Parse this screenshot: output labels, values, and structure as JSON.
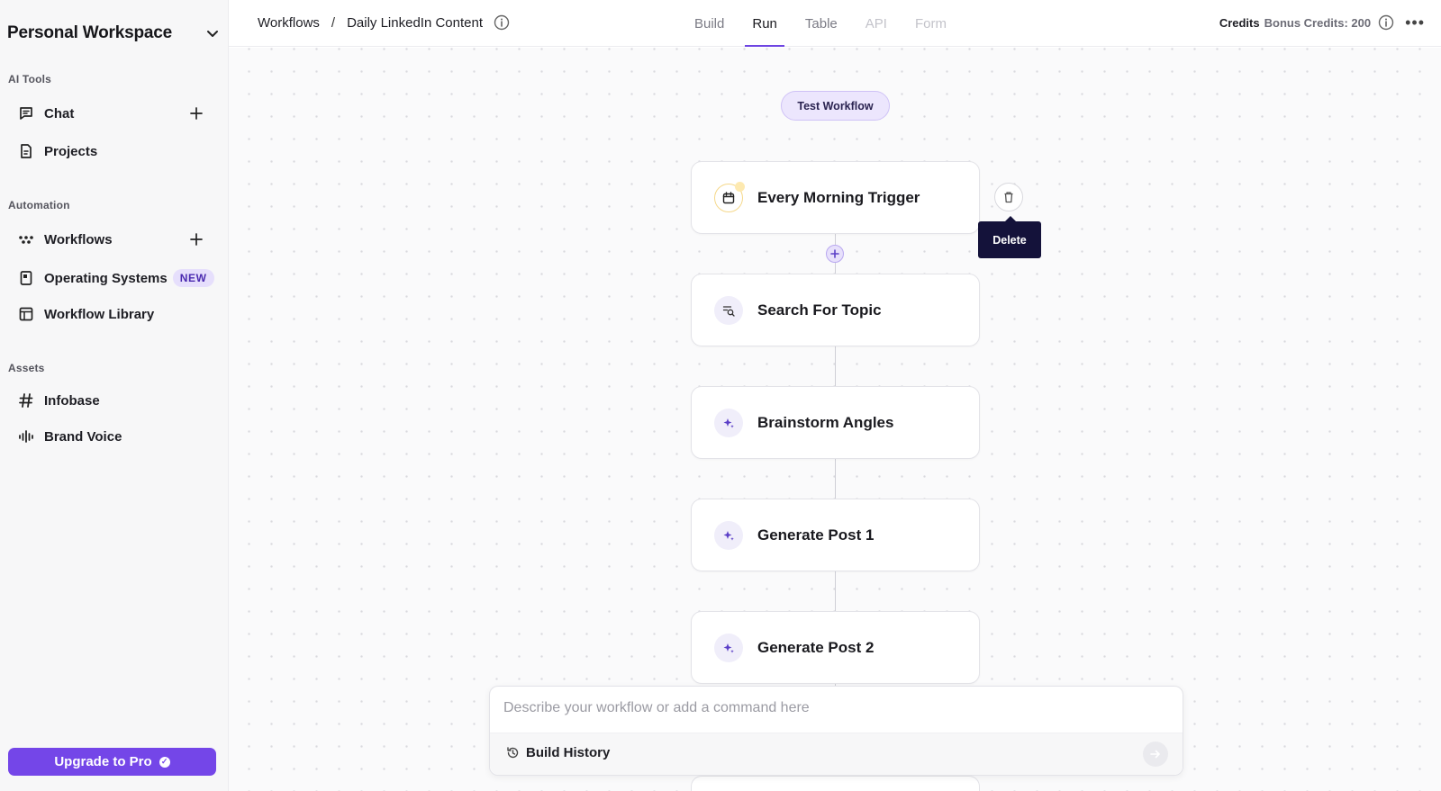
{
  "sidebar": {
    "workspace_title": "Personal Workspace",
    "sections": {
      "ai_tools": "AI Tools",
      "automation": "Automation",
      "assets": "Assets"
    },
    "items": {
      "chat": "Chat",
      "projects": "Projects",
      "workflows": "Workflows",
      "operating_systems": "Operating Systems",
      "operating_systems_badge": "NEW",
      "workflow_library": "Workflow Library",
      "infobase": "Infobase",
      "brand_voice": "Brand Voice"
    },
    "upgrade_label": "Upgrade to Pro"
  },
  "topbar": {
    "breadcrumb": [
      "Workflows",
      "Daily LinkedIn Content"
    ],
    "separator": "/",
    "tabs": [
      {
        "label": "Build",
        "state": "normal"
      },
      {
        "label": "Run",
        "state": "active"
      },
      {
        "label": "Table",
        "state": "normal"
      },
      {
        "label": "API",
        "state": "disabled"
      },
      {
        "label": "Form",
        "state": "disabled"
      }
    ],
    "credits_label": "Credits",
    "bonus_credits": "Bonus Credits: 200"
  },
  "canvas": {
    "test_workflow_label": "Test Workflow",
    "nodes": [
      {
        "title": "Every Morning Trigger",
        "icon": "calendar-icon"
      },
      {
        "title": "Search For Topic",
        "icon": "search-list-icon"
      },
      {
        "title": "Brainstorm Angles",
        "icon": "sparkle-icon"
      },
      {
        "title": "Generate Post 1",
        "icon": "sparkle-icon"
      },
      {
        "title": "Generate Post 2",
        "icon": "sparkle-icon"
      }
    ],
    "tooltip": "Delete"
  },
  "command": {
    "placeholder": "Describe your workflow or add a command here",
    "build_history_label": "Build History"
  },
  "colors": {
    "accent": "#7446e8",
    "tooltip_bg": "#14123a",
    "new_badge_bg": "#e6dffc"
  }
}
